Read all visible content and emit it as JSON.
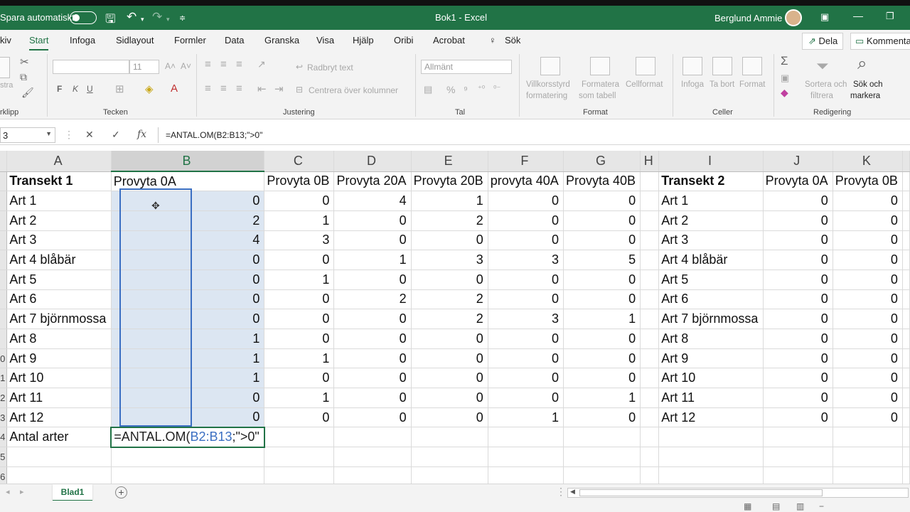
{
  "titlebar": {
    "autosave_label": "Spara automatiskt",
    "doc_title": "Bok1  -  Excel",
    "user_name": "Berglund Ammie"
  },
  "menu": {
    "tabs": [
      "kiv",
      "Start",
      "Infoga",
      "Sidlayout",
      "Formler",
      "Data",
      "Granska",
      "Visa",
      "Hjälp",
      "Oribi",
      "Acrobat",
      "Sök"
    ],
    "active_tab": "Start",
    "share": "Dela",
    "comments": "Kommenta"
  },
  "ribbon": {
    "clipboard_label": "rklipp",
    "clipboard_small": "stra",
    "font_label": "Tecken",
    "font_size": "11",
    "bold": "F",
    "italic": "K",
    "underline": "U",
    "alignment_label": "Justering",
    "wrap_text": "Radbryt text",
    "merge_center": "Centrera över kolumner",
    "number_label": "Tal",
    "number_format": "Allmänt",
    "conditional_formatting_1": "Villkorsstyrd",
    "conditional_formatting_2": "formatering",
    "format_as_table_1": "Formatera",
    "format_as_table_2": "som tabell",
    "cell_styles": "Cellformat",
    "styles_label": "Format",
    "insert": "Infoga",
    "delete": "Ta bort",
    "format": "Format",
    "cells_label": "Celler",
    "sort_filter_1": "Sortera och",
    "sort_filter_2": "filtrera",
    "find_select_1": "Sök och",
    "find_select_2": "markera",
    "editing_label": "Redigering"
  },
  "formula_bar": {
    "name_box": "3",
    "formula": "=ANTAL.OM(B2:B13;\">0\""
  },
  "columns": [
    "A",
    "B",
    "C",
    "D",
    "E",
    "F",
    "G",
    "H",
    "I",
    "J",
    "K"
  ],
  "row_numbers": [
    "",
    "",
    "",
    "",
    "",
    "",
    "",
    "",
    "",
    "0",
    "1",
    "2",
    "3",
    "4",
    "5",
    "6"
  ],
  "header_row": [
    "Transekt 1",
    "Provyta 0A",
    "Provyta 0B",
    "Provyta 20A",
    "Provyta 20B",
    "provyta 40A",
    "Provyta 40B",
    "",
    "Transekt 2",
    "Provyta 0A",
    "Provyta 0B"
  ],
  "rows": [
    [
      "Art 1",
      "0",
      "0",
      "4",
      "1",
      "0",
      "0",
      "",
      "Art 1",
      "0",
      "0"
    ],
    [
      "Art 2",
      "2",
      "1",
      "0",
      "2",
      "0",
      "0",
      "",
      "Art 2",
      "0",
      "0"
    ],
    [
      "Art 3",
      "4",
      "3",
      "0",
      "0",
      "0",
      "0",
      "",
      "Art 3",
      "0",
      "0"
    ],
    [
      "Art 4 blåbär",
      "0",
      "0",
      "1",
      "3",
      "3",
      "5",
      "",
      "Art 4 blåbär",
      "0",
      "0"
    ],
    [
      "Art 5",
      "0",
      "1",
      "0",
      "0",
      "0",
      "0",
      "",
      "Art 5",
      "0",
      "0"
    ],
    [
      "Art 6",
      "0",
      "0",
      "2",
      "2",
      "0",
      "0",
      "",
      "Art 6",
      "0",
      "0"
    ],
    [
      "Art 7 björnmossa",
      "0",
      "0",
      "0",
      "2",
      "3",
      "1",
      "",
      "Art 7 björnmossa",
      "0",
      "0"
    ],
    [
      "Art 8",
      "1",
      "0",
      "0",
      "0",
      "0",
      "0",
      "",
      "Art 8",
      "0",
      "0"
    ],
    [
      "Art 9",
      "1",
      "1",
      "0",
      "0",
      "0",
      "0",
      "",
      "Art 9",
      "0",
      "0"
    ],
    [
      "Art 10",
      "1",
      "0",
      "0",
      "0",
      "0",
      "0",
      "",
      "Art 10",
      "0",
      "0"
    ],
    [
      "Art 11",
      "0",
      "1",
      "0",
      "0",
      "0",
      "1",
      "",
      "Art 11",
      "0",
      "0"
    ],
    [
      "Art 12",
      "0",
      "0",
      "0",
      "0",
      "1",
      "0",
      "",
      "Art 12",
      "0",
      "0"
    ]
  ],
  "summary_row": {
    "label": "Antal arter",
    "formula_prefix": "=ANTAL.OM(",
    "formula_ref": "B2:B13",
    "formula_suffix": ";\">0\""
  },
  "sheet_tab": "Blad1",
  "colors": {
    "excel_green": "#217346",
    "selection_blue": "#3b6fc2",
    "selection_fill": "#dce6f2"
  }
}
